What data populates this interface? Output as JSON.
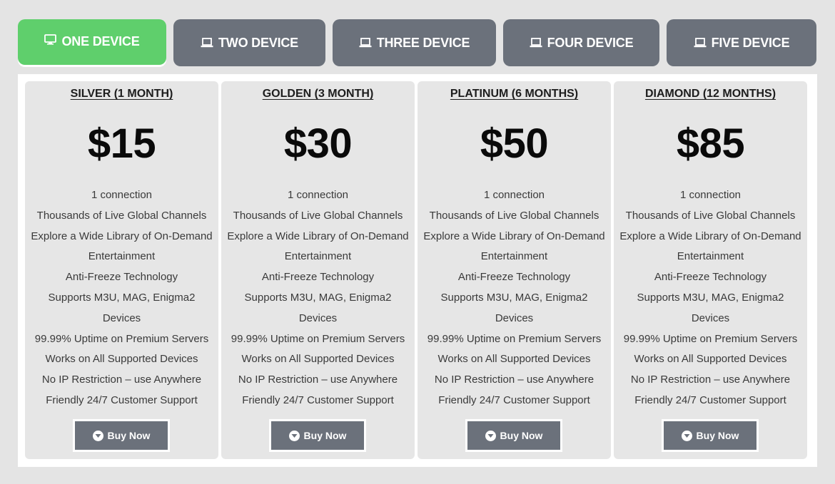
{
  "tabs": [
    {
      "label": "ONE DEVICE",
      "icon": "monitor-icon",
      "active": true
    },
    {
      "label": "TWO DEVICE",
      "icon": "laptop-icon",
      "active": false
    },
    {
      "label": "THREE DEVICE",
      "icon": "laptop-icon",
      "active": false
    },
    {
      "label": "FOUR DEVICE",
      "icon": "laptop-icon",
      "active": false
    },
    {
      "label": "FIVE DEVICE",
      "icon": "laptop-icon",
      "active": false
    }
  ],
  "colors": {
    "active_tab": "#5fcf6c",
    "inactive_tab": "#6b717b",
    "button": "#6b717b",
    "card_bg": "#e6e6e6"
  },
  "plans": [
    {
      "title": "SILVER (1 MONTH)",
      "price": "$15",
      "features": [
        "1 connection",
        "Thousands of Live Global Channels",
        "Explore a Wide Library of On-Demand Entertainment",
        "Anti-Freeze Technology",
        "Supports M3U, MAG, Enigma2 Devices",
        "99.99% Uptime on Premium Servers",
        "Works on All Supported Devices",
        "No IP Restriction – use Anywhere",
        "Friendly 24/7 Customer Support"
      ],
      "button_label": "Buy Now"
    },
    {
      "title": "GOLDEN (3 MONTH)",
      "price": "$30",
      "features": [
        "1 connection",
        "Thousands of Live Global Channels",
        "Explore a Wide Library of On-Demand Entertainment",
        "Anti-Freeze Technology",
        "Supports M3U, MAG, Enigma2 Devices",
        "99.99% Uptime on Premium Servers",
        "Works on All Supported Devices",
        "No IP Restriction – use Anywhere",
        "Friendly 24/7 Customer Support"
      ],
      "button_label": "Buy Now"
    },
    {
      "title": "PLATINUM (6 MONTHS)",
      "price": "$50",
      "features": [
        "1 connection",
        "Thousands of Live Global Channels",
        "Explore a Wide Library of On-Demand Entertainment",
        "Anti-Freeze Technology",
        "Supports M3U, MAG, Enigma2 Devices",
        "99.99% Uptime on Premium Servers",
        "Works on All Supported Devices",
        "No IP Restriction – use Anywhere",
        "Friendly 24/7 Customer Support"
      ],
      "button_label": "Buy Now"
    },
    {
      "title": "DIAMOND (12 MONTHS)",
      "price": "$85",
      "features": [
        "1 connection",
        "Thousands of Live Global Channels",
        "Explore a Wide Library of On-Demand Entertainment",
        "Anti-Freeze Technology",
        "Supports M3U, MAG, Enigma2 Devices",
        "99.99% Uptime on Premium Servers",
        "Works on All Supported Devices",
        "No IP Restriction – use Anywhere",
        "Friendly 24/7 Customer Support"
      ],
      "button_label": "Buy Now"
    }
  ]
}
